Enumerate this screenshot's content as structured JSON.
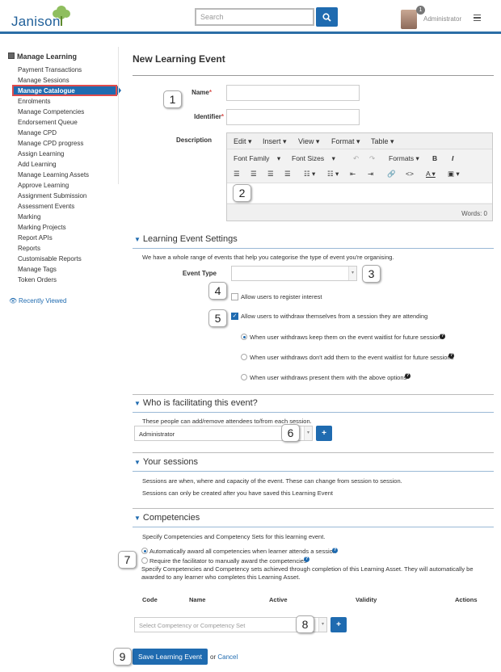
{
  "header": {
    "logo_text": "Janison",
    "search_placeholder": "Search",
    "notification_count": "1",
    "user_name": "Administrator"
  },
  "sidebar": {
    "title": "Manage Learning",
    "items": [
      "Payment Transactions",
      "Manage Sessions",
      "Manage Catalogue",
      "Enrolments",
      "Manage Competencies",
      "Endorsement Queue",
      "Manage CPD",
      "Manage CPD progress",
      "Assign Learning",
      "Add Learning",
      "Manage Learning Assets",
      "Approve Learning",
      "Assignment Submission",
      "Assessment Events",
      "Marking",
      "Marking Projects",
      "Report APIs",
      "Reports",
      "Customisable Reports",
      "Manage Tags",
      "Token Orders"
    ],
    "active_index": 2,
    "recently_viewed": "Recently Viewed"
  },
  "page": {
    "title": "New Learning Event",
    "name_label": "Name",
    "identifier_label": "Identifier",
    "description_label": "Description"
  },
  "editor": {
    "menus": [
      "Edit",
      "Insert",
      "View",
      "Format",
      "Table"
    ],
    "font_family": "Font Family",
    "font_sizes": "Font Sizes",
    "formats": "Formats",
    "bold": "B",
    "italic": "I",
    "words": "Words: 0"
  },
  "settings": {
    "title": "Learning Event Settings",
    "intro": "We have a whole range of events that help you categorise the type of event you're organising.",
    "event_type_label": "Event Type",
    "register_interest": "Allow users to register interest",
    "register_interest_checked": false,
    "allow_withdraw": "Allow users to withdraw themselves from a session they are attending",
    "allow_withdraw_checked": true,
    "withdraw_options": [
      "When user withdraws keep them on the event waitlist for future sessions",
      "When user withdraws don't add them to the event waitlist for future sessions",
      "When user withdraws present them with the above options"
    ],
    "withdraw_selected": 0
  },
  "facilitating": {
    "title": "Who is facilitating this event?",
    "intro": "These people can add/remove attendees to/from each session.",
    "selected": "Administrator",
    "add_label": "+"
  },
  "sessions": {
    "title": "Your sessions",
    "line1": "Sessions are when, where and capacity of the event. These can change from session to session.",
    "line2": "Sessions can only be created after you have saved this Learning Event"
  },
  "competencies": {
    "title": "Competencies",
    "intro": "Specify Competencies and Competency Sets for this learning event.",
    "option_auto": "Automatically award all competencies when learner attends a session",
    "option_manual": "Require the facilitator to manually award the competencies",
    "selected": 0,
    "note_line1": "Specify Competencies and Competency sets achieved through completion of this Learning Asset. They will automatically be",
    "note_line2": "awarded to any learner who completes this Learning Asset.",
    "columns": [
      "Code",
      "Name",
      "Active",
      "Validity",
      "Actions"
    ],
    "select_placeholder": "Select Competency or Competency Set",
    "add_label": "+"
  },
  "footer": {
    "save_label": "Save Learning Event",
    "or_text": "or",
    "cancel_label": "Cancel"
  },
  "callouts": [
    "1",
    "2",
    "3",
    "4",
    "5",
    "6",
    "7",
    "8",
    "9"
  ],
  "colors": {
    "accent": "#1f6bb0",
    "header_rule": "#2b6ea6",
    "highlight_border": "#e04b4b"
  }
}
